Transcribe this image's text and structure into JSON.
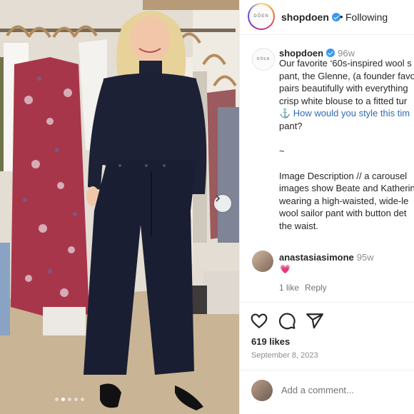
{
  "post": {
    "dots": 5,
    "active_dot": 1
  },
  "header": {
    "username": "shopdoen",
    "separator": "•",
    "follow_state": "Following",
    "avatar_text": "DÔEN"
  },
  "caption": {
    "avatar_text": "DÔEN",
    "username": "shopdoen",
    "time": "96w",
    "lines": [
      "Our favorite ‘60s-inspired wool s",
      "pant, the Glenne, (a founder favo",
      "pairs beautifully with everything",
      "crisp white blouse to a fitted tur",
      "⚓  How would you style this tim",
      "pant?",
      "",
      "~",
      "",
      "Image Description // a carousel",
      "images show Beate and Katherin",
      "wearing a high-waisted, wide-le",
      "wool sailor pant with button det",
      "the waist."
    ]
  },
  "comment": {
    "username": "anastasiasimone",
    "time": "95w",
    "text": "💗",
    "likes": "1 like",
    "reply": "Reply"
  },
  "actions": {
    "like_icon": "heart-icon",
    "comment_icon": "comment-icon",
    "share_icon": "share-icon",
    "likes": "619 likes",
    "date": "September 8, 2023",
    "comment_placeholder": "Add a comment..."
  },
  "colors": {
    "verified": "#3897f0",
    "text": "#262626",
    "muted": "#8e8e8e"
  }
}
